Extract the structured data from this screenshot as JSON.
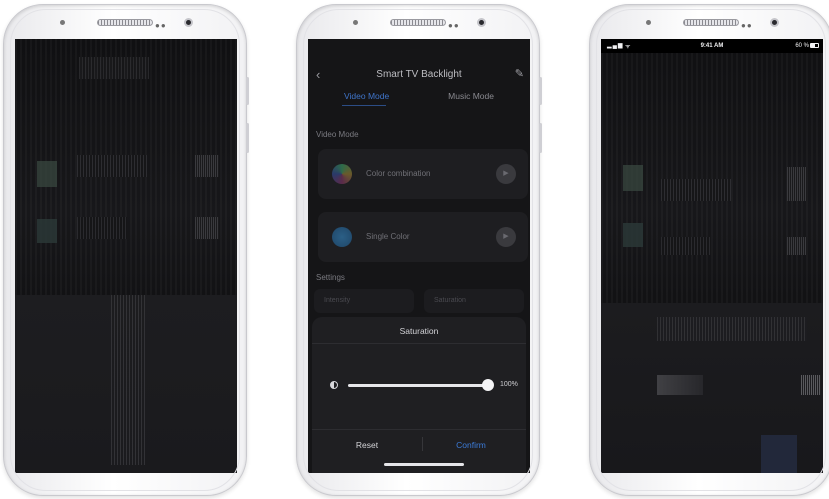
{
  "middle_screen": {
    "nav": {
      "title": "Smart TV Backlight",
      "back_glyph": "‹",
      "edit_glyph": "✎"
    },
    "tabs": [
      {
        "label": "Video Mode",
        "active": true
      },
      {
        "label": "Music Mode",
        "active": false
      }
    ],
    "video_mode_section": "Video Mode",
    "cards": [
      {
        "label": "Color combination",
        "icon": "color-wheel-icon"
      },
      {
        "label": "Single Color",
        "icon": "color-dot-icon"
      }
    ],
    "settings_section": "Settings",
    "setting_boxes": [
      "Intensity",
      "Saturation"
    ],
    "sheet": {
      "title": "Saturation",
      "slider_value": "100%",
      "slider_fraction": 1.0,
      "reset_label": "Reset",
      "confirm_label": "Confirm"
    }
  },
  "right_screen": {
    "status": {
      "signal": "▂▄▆",
      "wifi": "ᯤ",
      "time": "9:41 AM",
      "battery": "60 %"
    }
  },
  "colors": {
    "accent_blue": "#3b7bd8",
    "screen_bg": "#141416",
    "sheet_bg": "#1f1f22"
  }
}
